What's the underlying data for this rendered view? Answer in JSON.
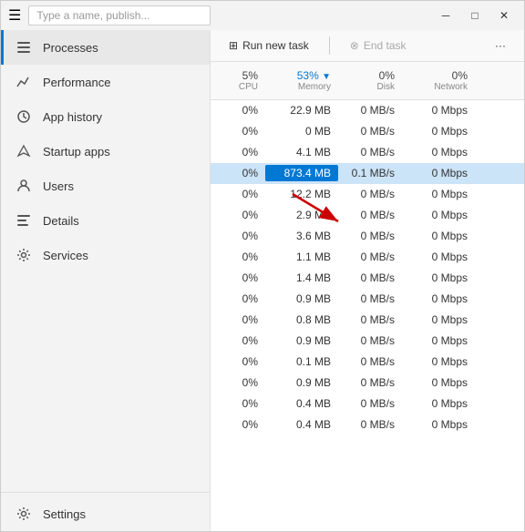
{
  "titlebar": {
    "hamburger": "☰",
    "search_placeholder": "Type a name, publish...",
    "min_label": "─",
    "max_label": "□",
    "close_label": "✕"
  },
  "sidebar": {
    "items": [
      {
        "id": "processes",
        "label": "Processes",
        "icon": "≡",
        "active": true
      },
      {
        "id": "performance",
        "label": "Performance",
        "icon": "📈"
      },
      {
        "id": "app-history",
        "label": "App history",
        "icon": "🕐"
      },
      {
        "id": "startup-apps",
        "label": "Startup apps",
        "icon": "🚀"
      },
      {
        "id": "users",
        "label": "Users",
        "icon": "👤"
      },
      {
        "id": "details",
        "label": "Details",
        "icon": "☰"
      },
      {
        "id": "services",
        "label": "Services",
        "icon": "⚙"
      }
    ],
    "bottom": [
      {
        "id": "settings",
        "label": "Settings",
        "icon": "⚙"
      }
    ]
  },
  "toolbar": {
    "run_new_task_label": "Run new task",
    "end_task_label": "End task",
    "more_label": "···"
  },
  "table": {
    "headers": [
      {
        "id": "cpu",
        "label": "5%",
        "sub": "CPU",
        "active": false
      },
      {
        "id": "memory",
        "label": "53%",
        "sub": "Memory",
        "active": true,
        "arrow": "▼"
      },
      {
        "id": "disk",
        "label": "0%",
        "sub": "Disk",
        "active": false
      },
      {
        "id": "network",
        "label": "0%",
        "sub": "Network",
        "active": false
      }
    ],
    "rows": [
      {
        "cpu": "0%",
        "memory": "22.9 MB",
        "disk": "0 MB/s",
        "network": "0 Mbps",
        "highlighted": false
      },
      {
        "cpu": "0%",
        "memory": "0 MB",
        "disk": "0 MB/s",
        "network": "0 Mbps",
        "highlighted": false
      },
      {
        "cpu": "0%",
        "memory": "4.1 MB",
        "disk": "0 MB/s",
        "network": "0 Mbps",
        "highlighted": false
      },
      {
        "cpu": "0%",
        "memory": "873.4 MB",
        "disk": "0.1 MB/s",
        "network": "0 Mbps",
        "highlighted": true,
        "memHighlight": true
      },
      {
        "cpu": "0%",
        "memory": "12.2 MB",
        "disk": "0 MB/s",
        "network": "0 Mbps",
        "highlighted": false
      },
      {
        "cpu": "0%",
        "memory": "2.9 MB",
        "disk": "0 MB/s",
        "network": "0 Mbps",
        "highlighted": false
      },
      {
        "cpu": "0%",
        "memory": "3.6 MB",
        "disk": "0 MB/s",
        "network": "0 Mbps",
        "highlighted": false
      },
      {
        "cpu": "0%",
        "memory": "1.1 MB",
        "disk": "0 MB/s",
        "network": "0 Mbps",
        "highlighted": false
      },
      {
        "cpu": "0%",
        "memory": "1.4 MB",
        "disk": "0 MB/s",
        "network": "0 Mbps",
        "highlighted": false
      },
      {
        "cpu": "0%",
        "memory": "0.9 MB",
        "disk": "0 MB/s",
        "network": "0 Mbps",
        "highlighted": false
      },
      {
        "cpu": "0%",
        "memory": "0.8 MB",
        "disk": "0 MB/s",
        "network": "0 Mbps",
        "highlighted": false
      },
      {
        "cpu": "0%",
        "memory": "0.9 MB",
        "disk": "0 MB/s",
        "network": "0 Mbps",
        "highlighted": false
      },
      {
        "cpu": "0%",
        "memory": "0.1 MB",
        "disk": "0 MB/s",
        "network": "0 Mbps",
        "highlighted": false
      },
      {
        "cpu": "0%",
        "memory": "0.9 MB",
        "disk": "0 MB/s",
        "network": "0 Mbps",
        "highlighted": false
      },
      {
        "cpu": "0%",
        "memory": "0.4 MB",
        "disk": "0 MB/s",
        "network": "0 Mbps",
        "highlighted": false
      },
      {
        "cpu": "0%",
        "memory": "0.4 MB",
        "disk": "0 MB/s",
        "network": "0 Mbps",
        "highlighted": false
      }
    ]
  }
}
